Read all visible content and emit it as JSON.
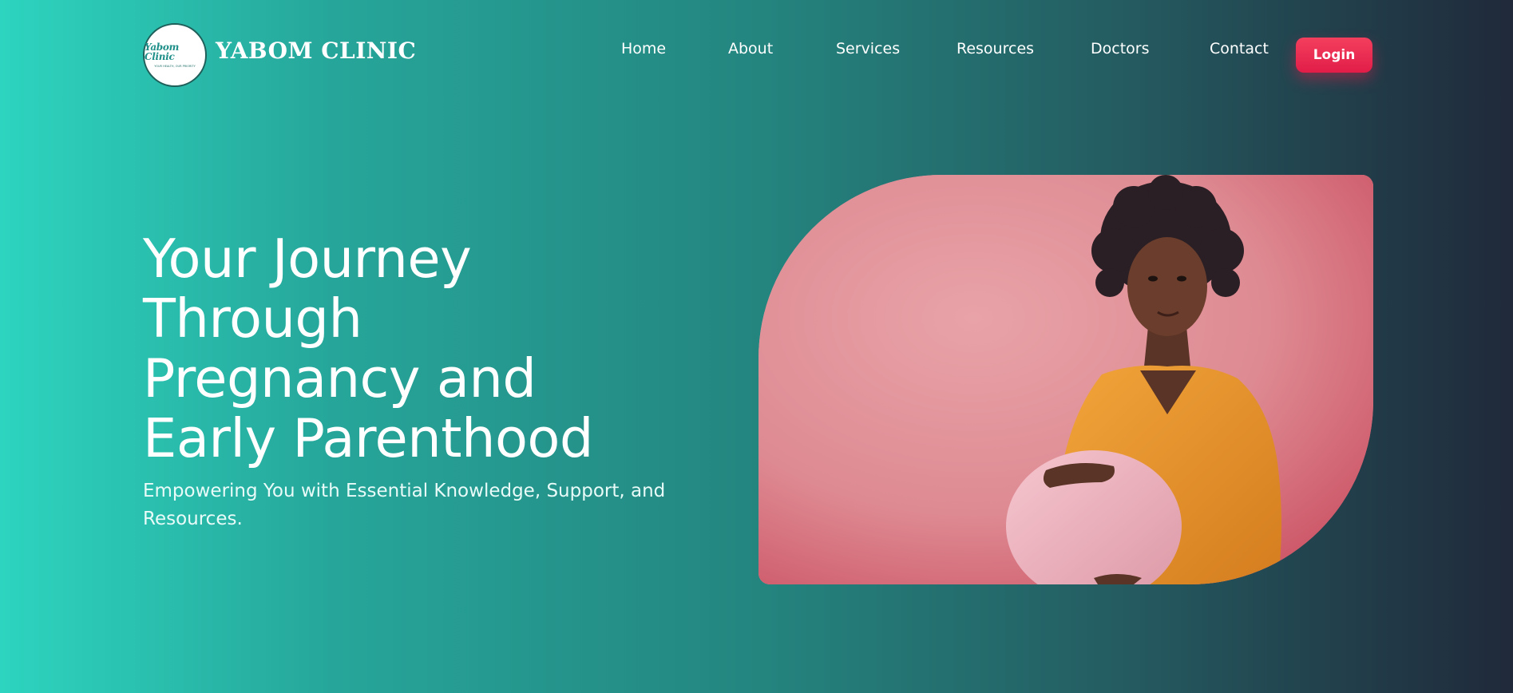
{
  "brand": {
    "logo_script": "Yabom Clinic",
    "logo_tagline": "YOUR HEALTH, OUR PRIORITY",
    "name": "YABOM CLINIC"
  },
  "nav": {
    "items": [
      {
        "label": "Home"
      },
      {
        "label": "About"
      },
      {
        "label": "Services"
      },
      {
        "label": "Resources"
      },
      {
        "label": "Doctors"
      },
      {
        "label": "Contact"
      }
    ],
    "login_label": "Login"
  },
  "hero": {
    "title_lines": [
      "Your Journey",
      "Through",
      "Pregnancy and",
      "Early Parenthood"
    ],
    "subtitle": "Empowering You with Essential Knowledge, Support, and Resources."
  },
  "colors": {
    "accent_teal": "#2dd4bf",
    "dark_end": "#20293a",
    "login_red": "#e11d48",
    "image_bg_pink": "#e59a9a",
    "dress_orange": "#e8962e"
  }
}
